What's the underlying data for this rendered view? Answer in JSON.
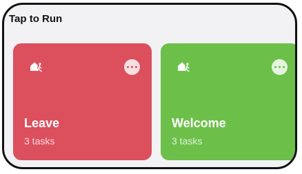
{
  "section": {
    "title": "Tap to Run"
  },
  "cards": [
    {
      "name": "Leave",
      "tasks": "3 tasks",
      "icon": "home-leave-icon",
      "color": "#dc4f5c"
    },
    {
      "name": "Welcome",
      "tasks": "3 tasks",
      "icon": "home-arrive-icon",
      "color": "#6cc04a"
    }
  ],
  "colors": {
    "background": "#f2f2f4",
    "frame": "#111111",
    "text_primary": "#111111",
    "card_text": "#ffffff"
  }
}
